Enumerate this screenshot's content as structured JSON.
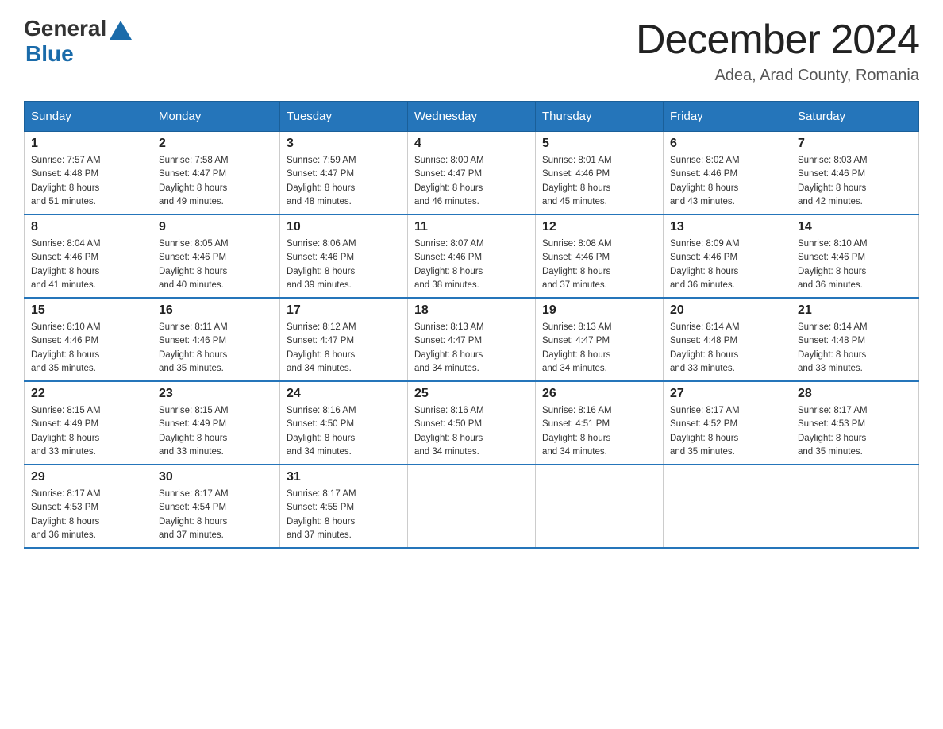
{
  "header": {
    "logo_general": "General",
    "logo_blue": "Blue",
    "month_title": "December 2024",
    "location": "Adea, Arad County, Romania"
  },
  "days_of_week": [
    "Sunday",
    "Monday",
    "Tuesday",
    "Wednesday",
    "Thursday",
    "Friday",
    "Saturday"
  ],
  "weeks": [
    [
      {
        "day": "1",
        "sunrise": "7:57 AM",
        "sunset": "4:48 PM",
        "daylight": "8 hours and 51 minutes."
      },
      {
        "day": "2",
        "sunrise": "7:58 AM",
        "sunset": "4:47 PM",
        "daylight": "8 hours and 49 minutes."
      },
      {
        "day": "3",
        "sunrise": "7:59 AM",
        "sunset": "4:47 PM",
        "daylight": "8 hours and 48 minutes."
      },
      {
        "day": "4",
        "sunrise": "8:00 AM",
        "sunset": "4:47 PM",
        "daylight": "8 hours and 46 minutes."
      },
      {
        "day": "5",
        "sunrise": "8:01 AM",
        "sunset": "4:46 PM",
        "daylight": "8 hours and 45 minutes."
      },
      {
        "day": "6",
        "sunrise": "8:02 AM",
        "sunset": "4:46 PM",
        "daylight": "8 hours and 43 minutes."
      },
      {
        "day": "7",
        "sunrise": "8:03 AM",
        "sunset": "4:46 PM",
        "daylight": "8 hours and 42 minutes."
      }
    ],
    [
      {
        "day": "8",
        "sunrise": "8:04 AM",
        "sunset": "4:46 PM",
        "daylight": "8 hours and 41 minutes."
      },
      {
        "day": "9",
        "sunrise": "8:05 AM",
        "sunset": "4:46 PM",
        "daylight": "8 hours and 40 minutes."
      },
      {
        "day": "10",
        "sunrise": "8:06 AM",
        "sunset": "4:46 PM",
        "daylight": "8 hours and 39 minutes."
      },
      {
        "day": "11",
        "sunrise": "8:07 AM",
        "sunset": "4:46 PM",
        "daylight": "8 hours and 38 minutes."
      },
      {
        "day": "12",
        "sunrise": "8:08 AM",
        "sunset": "4:46 PM",
        "daylight": "8 hours and 37 minutes."
      },
      {
        "day": "13",
        "sunrise": "8:09 AM",
        "sunset": "4:46 PM",
        "daylight": "8 hours and 36 minutes."
      },
      {
        "day": "14",
        "sunrise": "8:10 AM",
        "sunset": "4:46 PM",
        "daylight": "8 hours and 36 minutes."
      }
    ],
    [
      {
        "day": "15",
        "sunrise": "8:10 AM",
        "sunset": "4:46 PM",
        "daylight": "8 hours and 35 minutes."
      },
      {
        "day": "16",
        "sunrise": "8:11 AM",
        "sunset": "4:46 PM",
        "daylight": "8 hours and 35 minutes."
      },
      {
        "day": "17",
        "sunrise": "8:12 AM",
        "sunset": "4:47 PM",
        "daylight": "8 hours and 34 minutes."
      },
      {
        "day": "18",
        "sunrise": "8:13 AM",
        "sunset": "4:47 PM",
        "daylight": "8 hours and 34 minutes."
      },
      {
        "day": "19",
        "sunrise": "8:13 AM",
        "sunset": "4:47 PM",
        "daylight": "8 hours and 34 minutes."
      },
      {
        "day": "20",
        "sunrise": "8:14 AM",
        "sunset": "4:48 PM",
        "daylight": "8 hours and 33 minutes."
      },
      {
        "day": "21",
        "sunrise": "8:14 AM",
        "sunset": "4:48 PM",
        "daylight": "8 hours and 33 minutes."
      }
    ],
    [
      {
        "day": "22",
        "sunrise": "8:15 AM",
        "sunset": "4:49 PM",
        "daylight": "8 hours and 33 minutes."
      },
      {
        "day": "23",
        "sunrise": "8:15 AM",
        "sunset": "4:49 PM",
        "daylight": "8 hours and 33 minutes."
      },
      {
        "day": "24",
        "sunrise": "8:16 AM",
        "sunset": "4:50 PM",
        "daylight": "8 hours and 34 minutes."
      },
      {
        "day": "25",
        "sunrise": "8:16 AM",
        "sunset": "4:50 PM",
        "daylight": "8 hours and 34 minutes."
      },
      {
        "day": "26",
        "sunrise": "8:16 AM",
        "sunset": "4:51 PM",
        "daylight": "8 hours and 34 minutes."
      },
      {
        "day": "27",
        "sunrise": "8:17 AM",
        "sunset": "4:52 PM",
        "daylight": "8 hours and 35 minutes."
      },
      {
        "day": "28",
        "sunrise": "8:17 AM",
        "sunset": "4:53 PM",
        "daylight": "8 hours and 35 minutes."
      }
    ],
    [
      {
        "day": "29",
        "sunrise": "8:17 AM",
        "sunset": "4:53 PM",
        "daylight": "8 hours and 36 minutes."
      },
      {
        "day": "30",
        "sunrise": "8:17 AM",
        "sunset": "4:54 PM",
        "daylight": "8 hours and 37 minutes."
      },
      {
        "day": "31",
        "sunrise": "8:17 AM",
        "sunset": "4:55 PM",
        "daylight": "8 hours and 37 minutes."
      },
      null,
      null,
      null,
      null
    ]
  ],
  "labels": {
    "sunrise": "Sunrise:",
    "sunset": "Sunset:",
    "daylight": "Daylight:"
  }
}
